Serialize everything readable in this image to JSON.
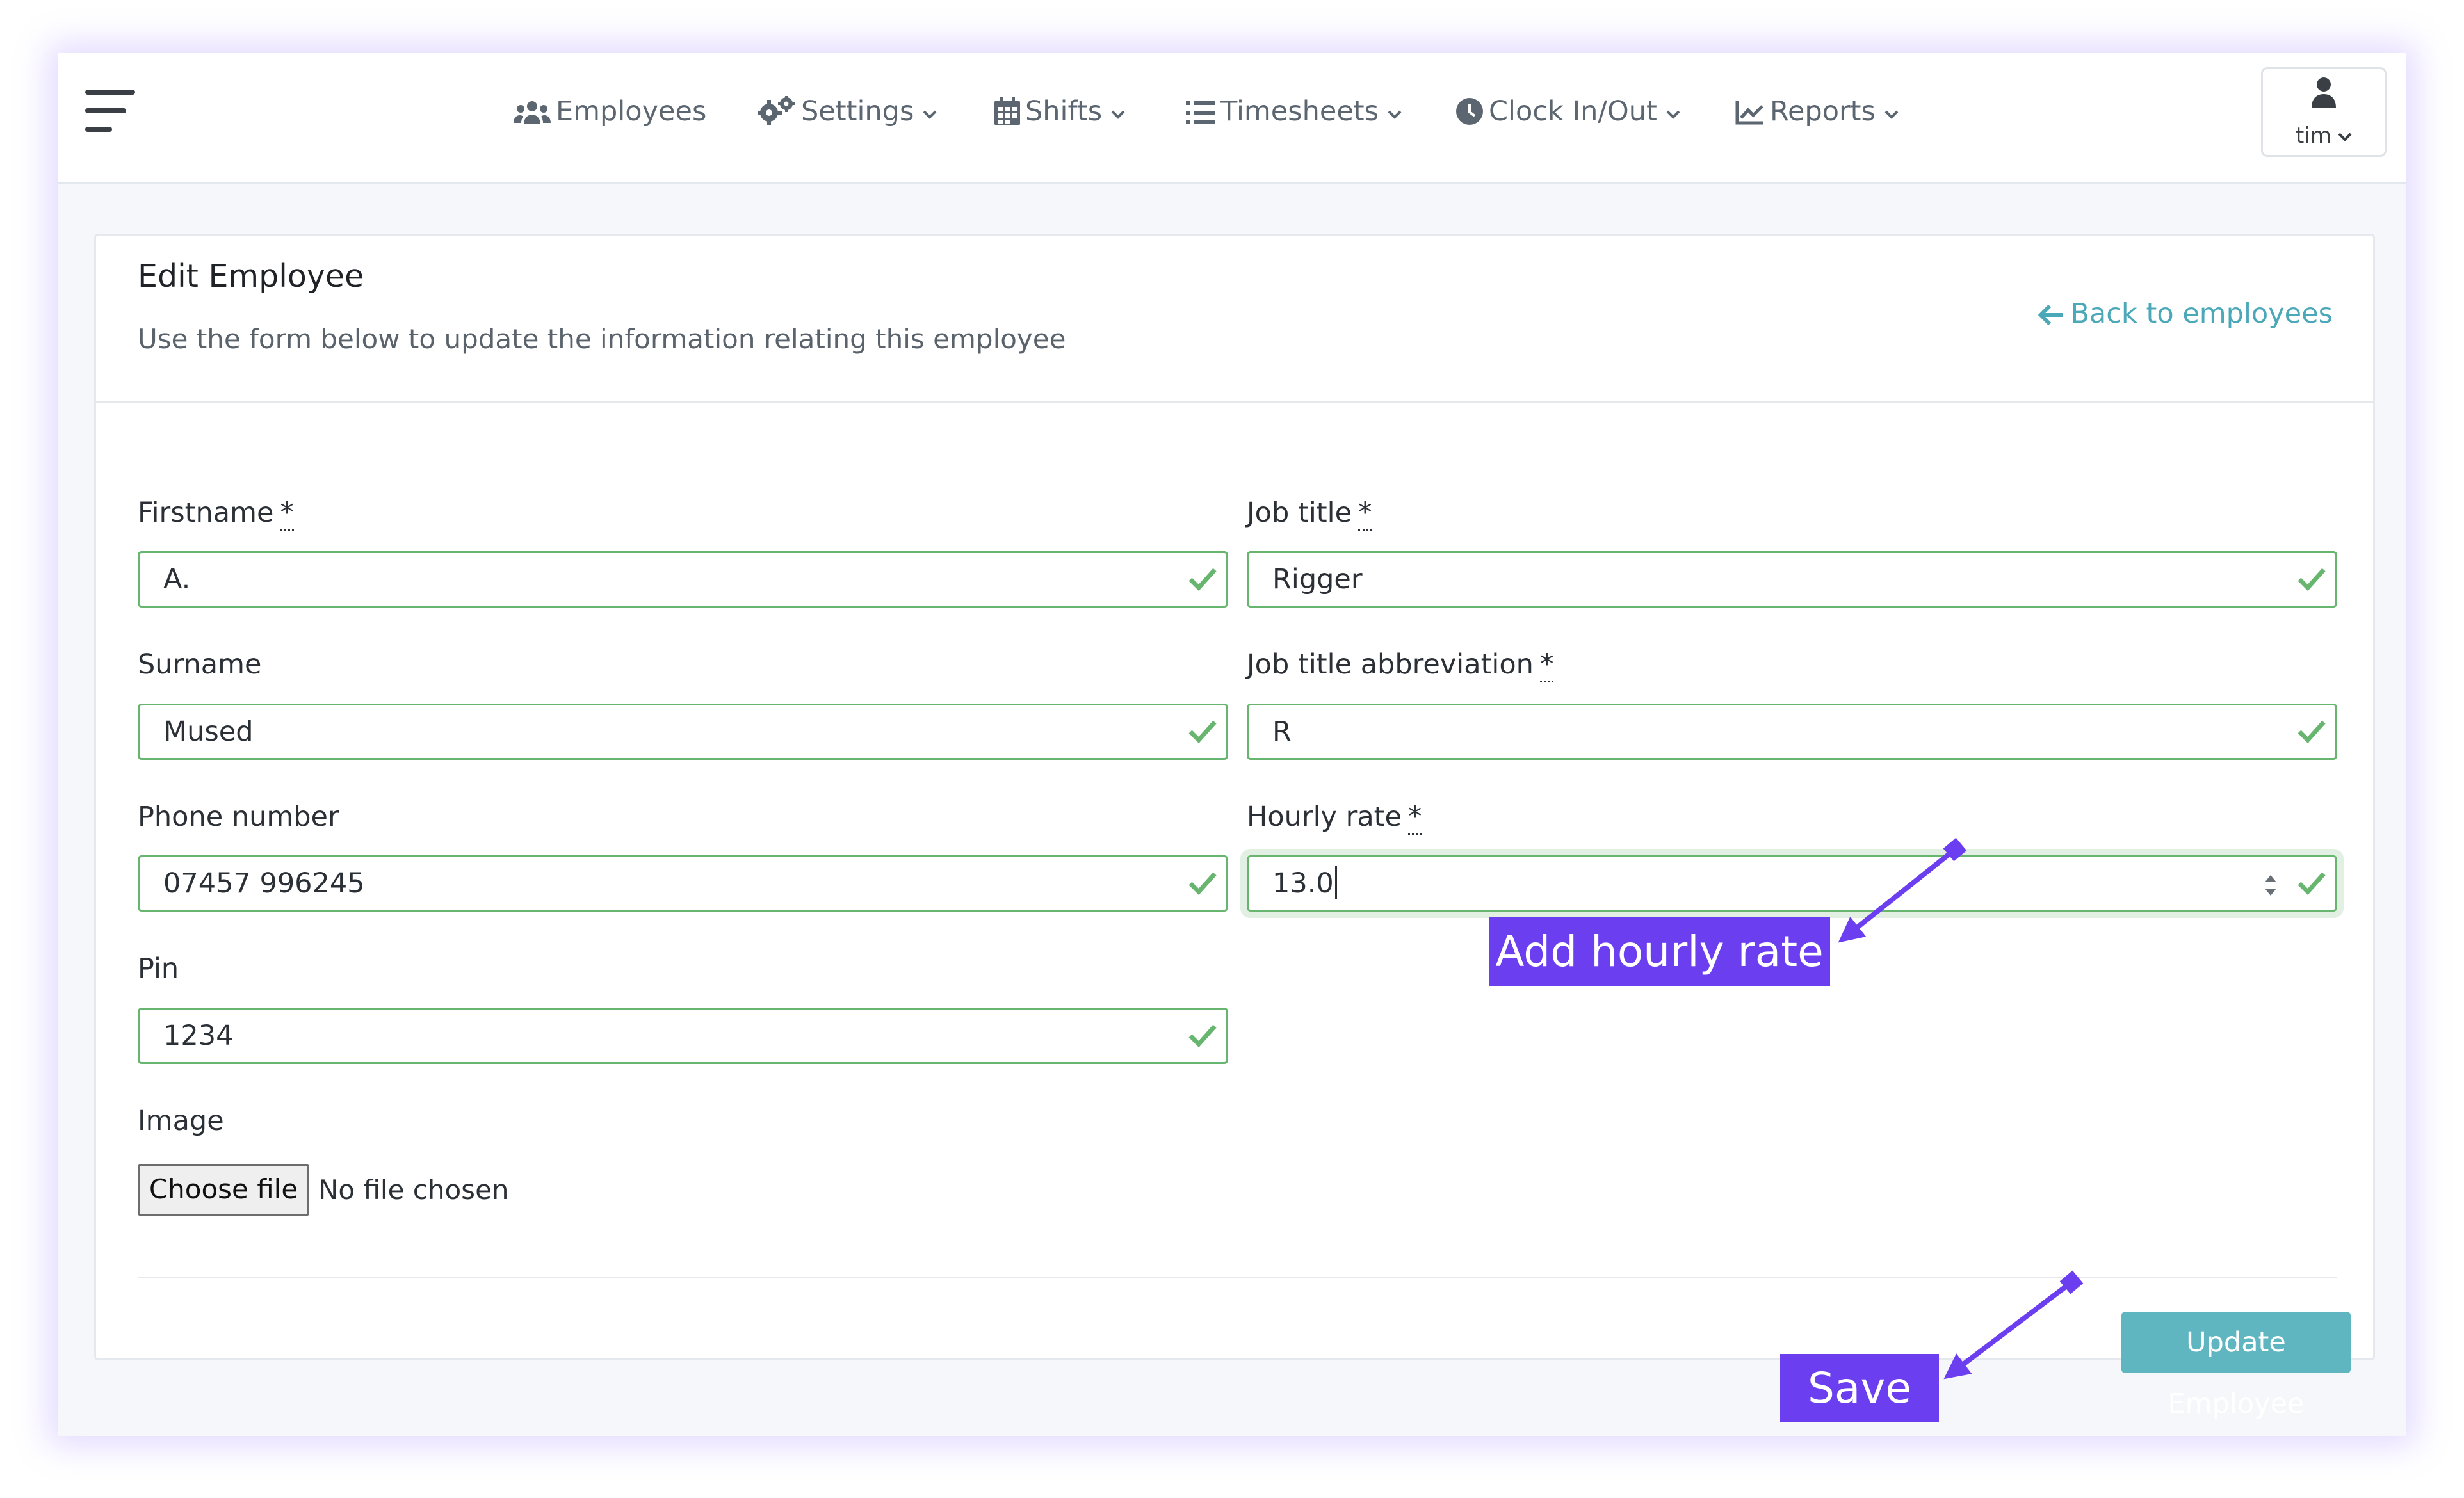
{
  "nav": {
    "items": [
      {
        "label": "Employees",
        "icon": "users-icon",
        "has_dropdown": false
      },
      {
        "label": "Settings",
        "icon": "gears-icon",
        "has_dropdown": true
      },
      {
        "label": "Shifts",
        "icon": "calendar-icon",
        "has_dropdown": true
      },
      {
        "label": "Timesheets",
        "icon": "list-icon",
        "has_dropdown": true
      },
      {
        "label": "Clock In/Out",
        "icon": "clock-icon",
        "has_dropdown": true
      },
      {
        "label": "Reports",
        "icon": "line-chart-icon",
        "has_dropdown": true
      }
    ],
    "user": {
      "name": "tim",
      "icon": "user-icon"
    }
  },
  "card": {
    "title": "Edit Employee",
    "subtitle": "Use the form below to update the information relating this employee",
    "back_link": "Back to employees"
  },
  "form": {
    "required_mark": "*",
    "firstname": {
      "label": "Firstname",
      "value": "A."
    },
    "surname": {
      "label": "Surname",
      "value": "Mused"
    },
    "phone": {
      "label": "Phone number",
      "value": "07457 996245"
    },
    "pin": {
      "label": "Pin",
      "value": "1234"
    },
    "job_title": {
      "label": "Job title",
      "value": "Rigger"
    },
    "job_title_abbr": {
      "label": "Job title abbreviation",
      "value": "R"
    },
    "hourly_rate": {
      "label": "Hourly rate",
      "value": "13.0"
    },
    "image": {
      "label": "Image",
      "button": "Choose file",
      "status": "No file chosen"
    },
    "submit": "Update Employee"
  },
  "callouts": {
    "hourly_rate": "Add hourly rate",
    "save": "Save"
  },
  "colors": {
    "accent": "#5fb6c1",
    "link": "#4aa8b8",
    "valid": "#67b56f",
    "callout": "#6b3ff0"
  }
}
